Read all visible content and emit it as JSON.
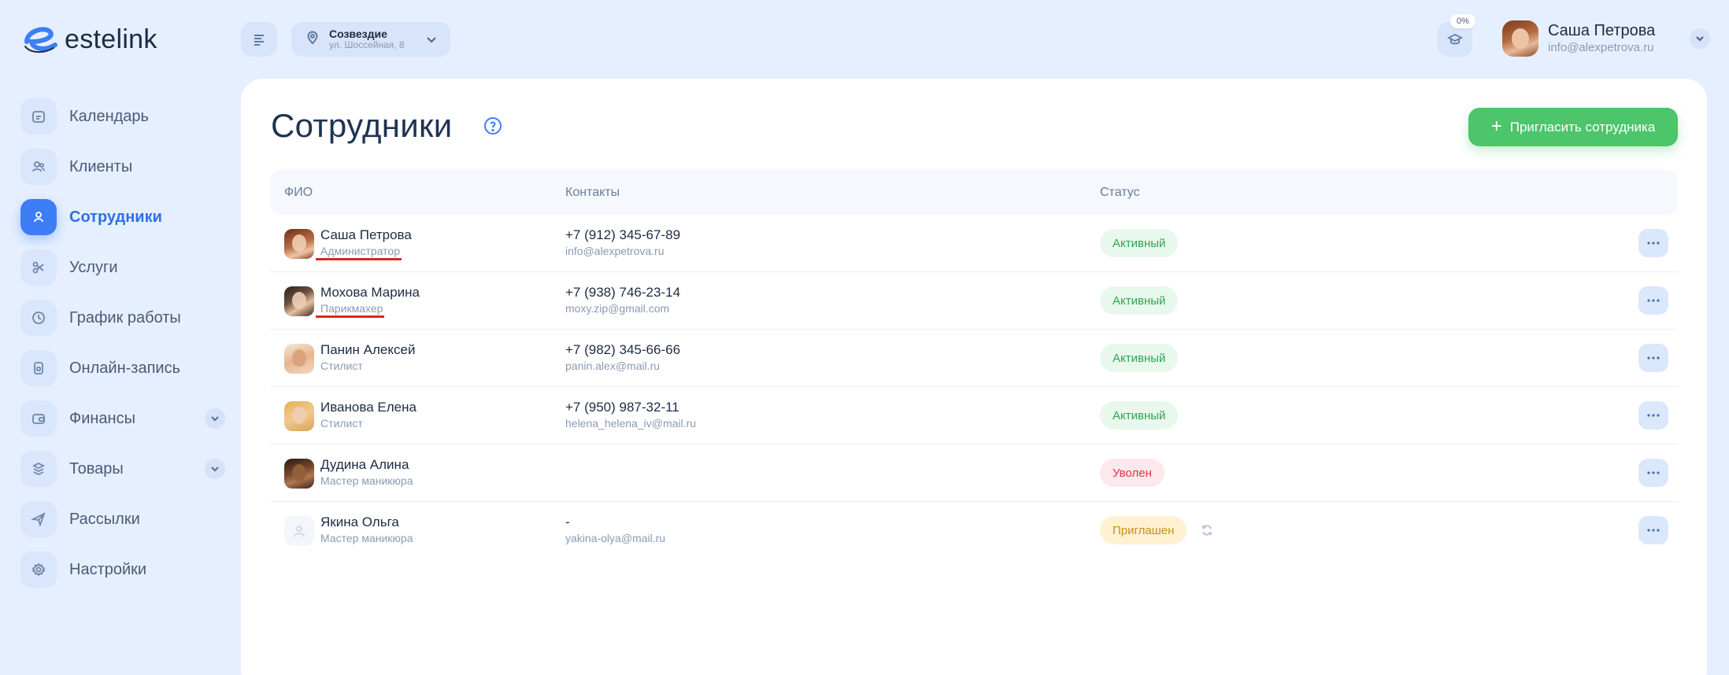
{
  "logo": {
    "text": "estelink"
  },
  "sidebar": {
    "items": [
      {
        "label": "Календарь",
        "icon": "calendar-icon"
      },
      {
        "label": "Клиенты",
        "icon": "clients-icon"
      },
      {
        "label": "Сотрудники",
        "icon": "employee-icon",
        "active": true
      },
      {
        "label": "Услуги",
        "icon": "scissors-icon"
      },
      {
        "label": "График работы",
        "icon": "clock-icon"
      },
      {
        "label": "Онлайн-запись",
        "icon": "phone-icon"
      },
      {
        "label": "Финансы",
        "icon": "wallet-icon",
        "expandable": true
      },
      {
        "label": "Товары",
        "icon": "products-icon",
        "expandable": true
      },
      {
        "label": "Рассылки",
        "icon": "send-icon"
      },
      {
        "label": "Настройки",
        "icon": "gear-icon"
      }
    ]
  },
  "header": {
    "location": {
      "name": "Созвездие",
      "address": "ул. Шоссейная, 8"
    },
    "progress": "0%",
    "user": {
      "name": "Саша Петрова",
      "email": "info@alexpetrova.ru"
    }
  },
  "page": {
    "title": "Сотрудники",
    "invite_button": "Пригласить сотрудника"
  },
  "table": {
    "columns": [
      "ФИО",
      "Контакты",
      "Статус"
    ],
    "rows": [
      {
        "name": "Саша Петрова",
        "role": "Администратор",
        "phone": "+7 (912) 345-67-89",
        "email": "info@alexpetrova.ru",
        "status": "Активный"
      },
      {
        "name": "Мохова Марина",
        "role": "Парикмахер",
        "phone": "+7 (938) 746-23-14",
        "email": "moxy.zip@gmail.com",
        "status": "Активный"
      },
      {
        "name": "Панин Алексей",
        "role": "Стилист",
        "phone": "+7 (982) 345-66-66",
        "email": "panin.alex@mail.ru",
        "status": "Активный"
      },
      {
        "name": "Иванова Елена",
        "role": "Стилист",
        "phone": "+7 (950) 987-32-11",
        "email": "helena_helena_iv@mail.ru",
        "status": "Активный"
      },
      {
        "name": "Дудина Алина",
        "role": "Мастер маникюра",
        "phone": "",
        "email": "",
        "status": "Уволен"
      },
      {
        "name": "Якина Ольга",
        "role": "Мастер маникюра",
        "phone": "-",
        "email": "yakina-olya@mail.ru",
        "status": "Приглашен"
      }
    ]
  },
  "colors": {
    "accent": "#3d7df6",
    "invite": "#4cc56b",
    "active": "#2fa552",
    "fired": "#d9364f",
    "invited": "#c6921a",
    "underline_annotation": "#e02424"
  }
}
